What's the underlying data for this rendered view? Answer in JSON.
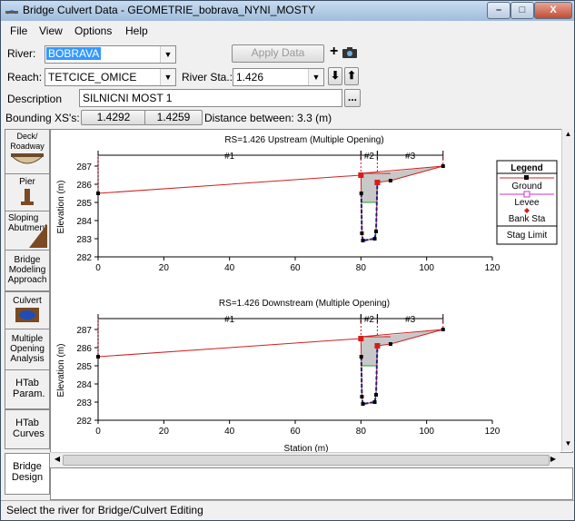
{
  "window": {
    "title": "Bridge Culvert Data - GEOMETRIE_bobrava_NYNI_MOSTY",
    "min": "–",
    "max": "□",
    "close": "X"
  },
  "menu": [
    "File",
    "View",
    "Options",
    "Help"
  ],
  "form": {
    "river_label": "River:",
    "river_value": "BOBRAVA",
    "reach_label": "Reach:",
    "reach_value": "TETCICE_OMICE",
    "river_sta_label": "River Sta.:",
    "river_sta_value": "1.426",
    "apply_label": "Apply Data",
    "description_label": "Description",
    "description_value": "SILNICNI MOST 1",
    "bounding_label": "Bounding XS's:",
    "bounding_up": "1.4292",
    "bounding_down": "1.4259",
    "distance_text": "Distance between: 3.3 (m)",
    "ellipsis": "..."
  },
  "sidebar": [
    {
      "name": "deck-roadway",
      "label": "Deck/ Roadway"
    },
    {
      "name": "pier",
      "label": "Pier"
    },
    {
      "name": "sloping-abutment",
      "label": "Sloping Abutment"
    },
    {
      "name": "bridge-modeling-approach",
      "label": "Bridge Modeling Approach"
    },
    {
      "name": "culvert",
      "label": "Culvert"
    },
    {
      "name": "multiple-opening-analysis",
      "label": "Multiple Opening Analysis"
    },
    {
      "name": "htab-param",
      "label": "HTab Param."
    },
    {
      "name": "htab-curves",
      "label": "HTab Curves"
    },
    {
      "name": "bridge-design",
      "label": "Bridge Design"
    }
  ],
  "status_text": "Select the river for Bridge/Culvert Editing",
  "colors": {
    "ground": "#d02020",
    "levee": "#cc33cc",
    "bank": "#d81b1b",
    "channel": "#1a237e"
  },
  "chart_data": [
    {
      "type": "line",
      "title": "RS=1.426   Upstream  (Multiple Opening)",
      "xlabel": "",
      "ylabel": "Elevation (m)",
      "xlim": [
        0,
        120
      ],
      "ylim": [
        282,
        287.5
      ],
      "xticks": [
        0,
        20,
        40,
        60,
        80,
        100,
        120
      ],
      "yticks": [
        282,
        283,
        284,
        285,
        286,
        287
      ],
      "openings": [
        {
          "label": "#1",
          "from": 0,
          "to": 80
        },
        {
          "label": "#2",
          "from": 80,
          "to": 85
        },
        {
          "label": "#3",
          "from": 85,
          "to": 105
        }
      ],
      "ground": [
        [
          0,
          285.5
        ],
        [
          80,
          286.5
        ],
        [
          80.1,
          285.5
        ],
        [
          80.3,
          283.3
        ],
        [
          80.6,
          282.9
        ],
        [
          84.2,
          283.0
        ],
        [
          84.6,
          283.4
        ],
        [
          85,
          286.1
        ],
        [
          89,
          286.2
        ],
        [
          105,
          287.0
        ]
      ],
      "deck_high": [
        [
          80,
          286.6
        ],
        [
          105,
          287.0
        ]
      ],
      "bank_stations": [
        [
          80,
          286.5
        ],
        [
          85,
          286.1
        ]
      ],
      "legend": [
        "Legend",
        "Ground",
        "Levee",
        "Bank Sta",
        "Stag Limit"
      ]
    },
    {
      "type": "line",
      "title": "RS=1.426   Downstream  (Multiple Opening)",
      "xlabel": "Station (m)",
      "ylabel": "Elevation (m)",
      "xlim": [
        0,
        120
      ],
      "ylim": [
        282,
        287.5
      ],
      "xticks": [
        0,
        20,
        40,
        60,
        80,
        100,
        120
      ],
      "yticks": [
        282,
        283,
        284,
        285,
        286,
        287
      ],
      "openings": [
        {
          "label": "#1",
          "from": 0,
          "to": 80
        },
        {
          "label": "#2",
          "from": 80,
          "to": 85
        },
        {
          "label": "#3",
          "from": 85,
          "to": 105
        }
      ],
      "ground": [
        [
          0,
          285.5
        ],
        [
          80,
          286.5
        ],
        [
          80.1,
          285.5
        ],
        [
          80.3,
          283.3
        ],
        [
          80.6,
          282.9
        ],
        [
          84.2,
          283.0
        ],
        [
          84.6,
          283.4
        ],
        [
          85,
          286.1
        ],
        [
          89,
          286.2
        ],
        [
          105,
          287.0
        ]
      ],
      "deck_high": [
        [
          80,
          286.6
        ],
        [
          105,
          287.0
        ]
      ],
      "bank_stations": [
        [
          80,
          286.5
        ],
        [
          85,
          286.1
        ]
      ]
    }
  ]
}
